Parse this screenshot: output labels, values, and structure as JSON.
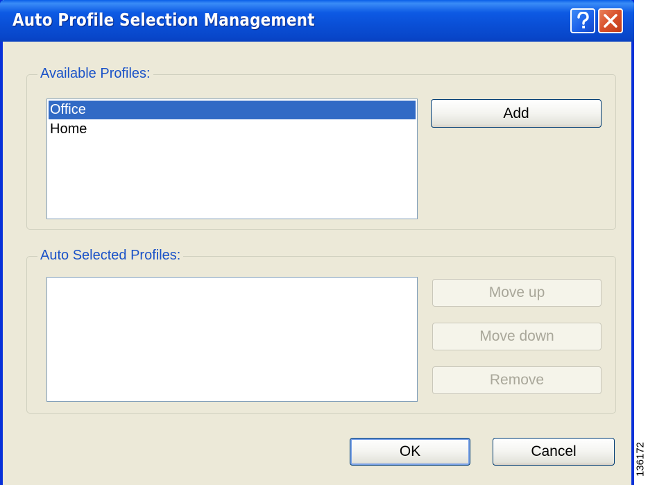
{
  "window": {
    "title": "Auto Profile Selection Management",
    "help_icon": "question-mark-icon",
    "close_icon": "close-x-icon"
  },
  "available_profiles": {
    "label": "Available Profiles:",
    "items": [
      {
        "label": "Office",
        "selected": true
      },
      {
        "label": "Home",
        "selected": false
      }
    ],
    "add_button": "Add"
  },
  "auto_selected_profiles": {
    "label": "Auto Selected Profiles:",
    "items": [],
    "move_up_button": "Move up",
    "move_down_button": "Move down",
    "remove_button": "Remove"
  },
  "footer": {
    "ok_button": "OK",
    "cancel_button": "Cancel"
  },
  "figure_number": "136172",
  "colors": {
    "titlebar": "#0a4fd6",
    "selection": "#316ac5",
    "group_label": "#1a52c8",
    "dialog_bg": "#ece9d8"
  }
}
